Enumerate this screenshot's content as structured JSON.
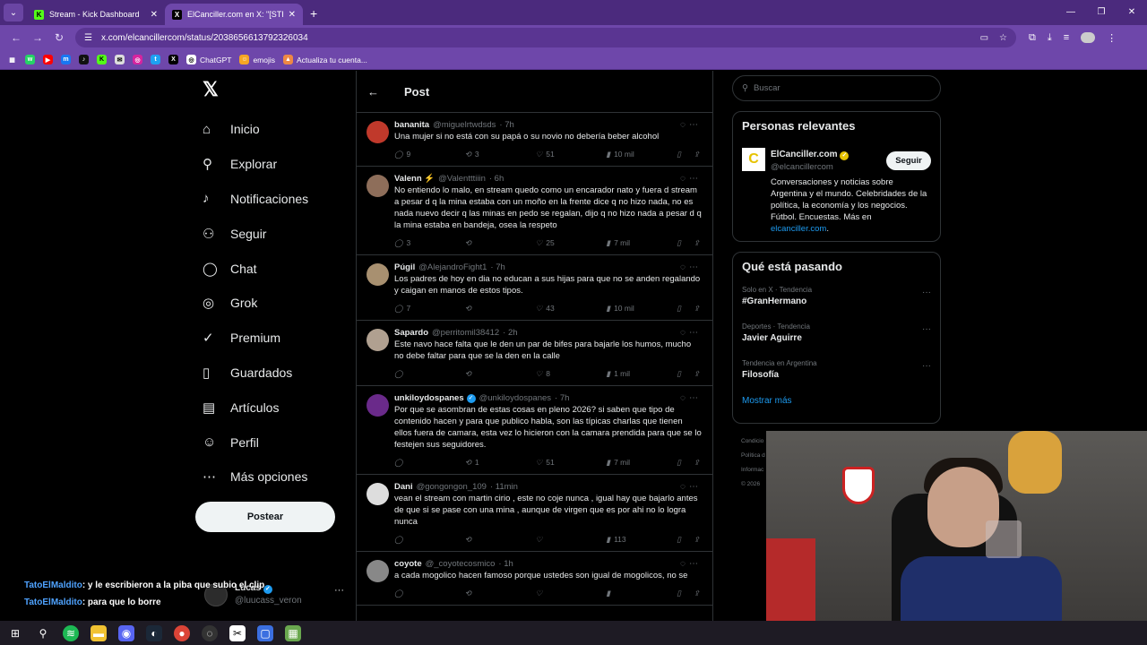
{
  "browser": {
    "tabs": [
      {
        "title": "Stream - Kick Dashboard",
        "fav": "K",
        "fav_color": "#53fc18"
      },
      {
        "title": "ElCanciller.com en X: \"[STREAM",
        "fav": "X",
        "fav_color": "#000000"
      }
    ],
    "url": "x.com/elcancillercom/status/2038656613792326034",
    "bookmarks": [
      "ChatGPT",
      "emojis",
      "Actualiza tu cuenta..."
    ]
  },
  "nav": {
    "items": [
      {
        "label": "Inicio",
        "icon": "home-icon",
        "glyph": "⌂"
      },
      {
        "label": "Explorar",
        "icon": "search-icon",
        "glyph": "⚲"
      },
      {
        "label": "Notificaciones",
        "icon": "bell-icon",
        "glyph": "♪"
      },
      {
        "label": "Seguir",
        "icon": "person-add-icon",
        "glyph": "⚇"
      },
      {
        "label": "Chat",
        "icon": "chat-icon",
        "glyph": "◯"
      },
      {
        "label": "Grok",
        "icon": "grok-icon",
        "glyph": "◎"
      },
      {
        "label": "Premium",
        "icon": "premium-icon",
        "glyph": "✓"
      },
      {
        "label": "Guardados",
        "icon": "bookmark-icon",
        "glyph": "▯"
      },
      {
        "label": "Artículos",
        "icon": "article-icon",
        "glyph": "▤"
      },
      {
        "label": "Perfil",
        "icon": "profile-icon",
        "glyph": "☺"
      },
      {
        "label": "Más opciones",
        "icon": "more-icon",
        "glyph": "⋯"
      }
    ],
    "post_label": "Postear"
  },
  "account": {
    "name": "Lucas",
    "handle": "@luucass_veron"
  },
  "chat": [
    {
      "user": "TatoElMaldito",
      "text": ": y le escribieron a la piba que subio el clip"
    },
    {
      "user": "TatoElMaldito",
      "text": ": para que lo borre"
    }
  ],
  "header": {
    "title": "Post"
  },
  "tweets": [
    {
      "name": "bananita",
      "handle": "@miguelrtwdsds",
      "time": "· 7h",
      "text": "Una mujer si no está con su papá o su novio no debería beber alcohol",
      "replies": "9",
      "retweets": "3",
      "likes": "51",
      "views": "10 mil",
      "color": "#c0392b"
    },
    {
      "name": "Valenn ⚡",
      "handle": "@Valentttiiin",
      "time": "· 6h",
      "text": "No entiendo lo malo, en stream quedo como un encarador nato y fuera d stream a pesar d q la mina estaba con un moño en la frente dice q no hizo nada, no es nada nuevo decir q las minas en pedo se regalan, dijo q no hizo nada a pesar d q la mina estaba en bandeja, osea la respeto",
      "replies": "3",
      "retweets": "",
      "likes": "25",
      "views": "7 mil",
      "color": "#8e6e5a"
    },
    {
      "name": "Púgil",
      "handle": "@AlejandroFight1",
      "time": "· 7h",
      "text": "Los padres de hoy en dia no educan a sus hijas para que no se anden regalando y caigan en manos de estos tipos.",
      "replies": "7",
      "retweets": "",
      "likes": "43",
      "views": "10 mil",
      "color": "#a89070"
    },
    {
      "name": "Sapardo",
      "handle": "@perritomil38412",
      "time": "· 2h",
      "text": "Este navo hace falta que le den un par de bifes para bajarle los humos, mucho no debe faltar para que se la den en la calle",
      "replies": "",
      "retweets": "",
      "likes": "8",
      "views": "1 mil",
      "color": "#b0a090"
    },
    {
      "name": "unkiloydospanes",
      "handle": "@unkiloydospanes",
      "time": "· 7h",
      "text": "Por que se asombran de estas cosas en pleno 2026? si saben que tipo de contenido hacen y para que publico habla, son las típicas charlas que tienen ellos fuera de camara, esta vez lo hicieron con la camara prendida para que se lo festejen sus seguidores.",
      "replies": "",
      "retweets": "1",
      "likes": "51",
      "views": "7 mil",
      "color": "#6a2a8a",
      "verified": true
    },
    {
      "name": "Dani",
      "handle": "@gongongon_109",
      "time": "· 11min",
      "text": "vean el stream con martin cirio , este no coje nunca , igual hay que bajarlo antes de que si se pase con una mina , aunque de virgen que es por ahi no lo logra nunca",
      "replies": "",
      "retweets": "",
      "likes": "",
      "views": "113",
      "color": "#ddd"
    },
    {
      "name": "coyote",
      "handle": "@_coyotecosmico",
      "time": "· 1h",
      "text": "a cada mogolico hacen famoso porque ustedes son igual de mogolicos, no se",
      "replies": "",
      "retweets": "",
      "likes": "",
      "views": "",
      "color": "#888"
    }
  ],
  "search": {
    "placeholder": "Buscar"
  },
  "relevant": {
    "title": "Personas relevantes",
    "name": "ElCanciller.com",
    "handle": "@elcancillercom",
    "follow": "Seguir",
    "bio": "Conversaciones y noticias sobre Argentina y el mundo. Celebridades de la política, la economía y los negocios. Fútbol. Encuestas. Más en",
    "link": "elcanciller.com",
    "bio_end": "."
  },
  "trends": {
    "title": "Qué está pasando",
    "items": [
      {
        "context": "Solo en X · Tendencia",
        "name": "#GranHermano"
      },
      {
        "context": "Deportes · Tendencia",
        "name": "Javier Aguirre"
      },
      {
        "context": "Tendencia en Argentina",
        "name": "Filosofía"
      }
    ],
    "more": "Mostrar más"
  },
  "footer": [
    "Condicio",
    "Política d",
    "Informac",
    "© 2026"
  ]
}
